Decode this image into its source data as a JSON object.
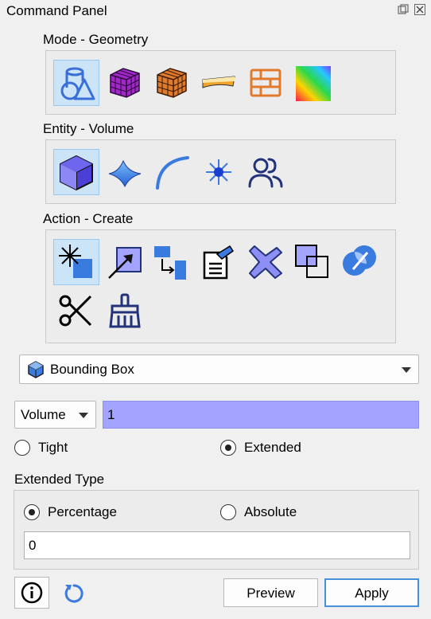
{
  "panel": {
    "title": "Command Panel"
  },
  "mode": {
    "label": "Mode - Geometry",
    "tools": [
      "geometry-mode-icon",
      "mesh-mode-icon",
      "hex-mesh-icon",
      "surface-strip-icon",
      "brick-wall-icon",
      "gradient-icon"
    ],
    "selected": 0
  },
  "entity": {
    "label": "Entity - Volume",
    "tools": [
      "volume-cube-icon",
      "surface-icon",
      "curve-arc-icon",
      "vertex-icon",
      "group-users-icon"
    ],
    "selected": 0
  },
  "action": {
    "label": "Action - Create",
    "tools": [
      "create-icon",
      "modify-icon",
      "transform-icon",
      "properties-icon",
      "delete-icon",
      "overlap-icon",
      "boolean-icon",
      "cut-scissors-icon",
      "cleanup-broom-icon"
    ],
    "selected": 0
  },
  "command": {
    "selected_label": "Bounding Box"
  },
  "entity_type": {
    "selected_label": "Volume"
  },
  "id_field": {
    "value": "1"
  },
  "box_type": {
    "tight_label": "Tight",
    "extended_label": "Extended",
    "selected": "Extended"
  },
  "extended_type": {
    "label": "Extended Type",
    "percentage_label": "Percentage",
    "absolute_label": "Absolute",
    "selected": "Percentage",
    "value": "0"
  },
  "footer": {
    "preview_label": "Preview",
    "apply_label": "Apply"
  },
  "colors": {
    "selected_bg": "#cce4f7",
    "id_field_bg": "#a3a4ff",
    "accent_blue": "#3a7be0"
  }
}
